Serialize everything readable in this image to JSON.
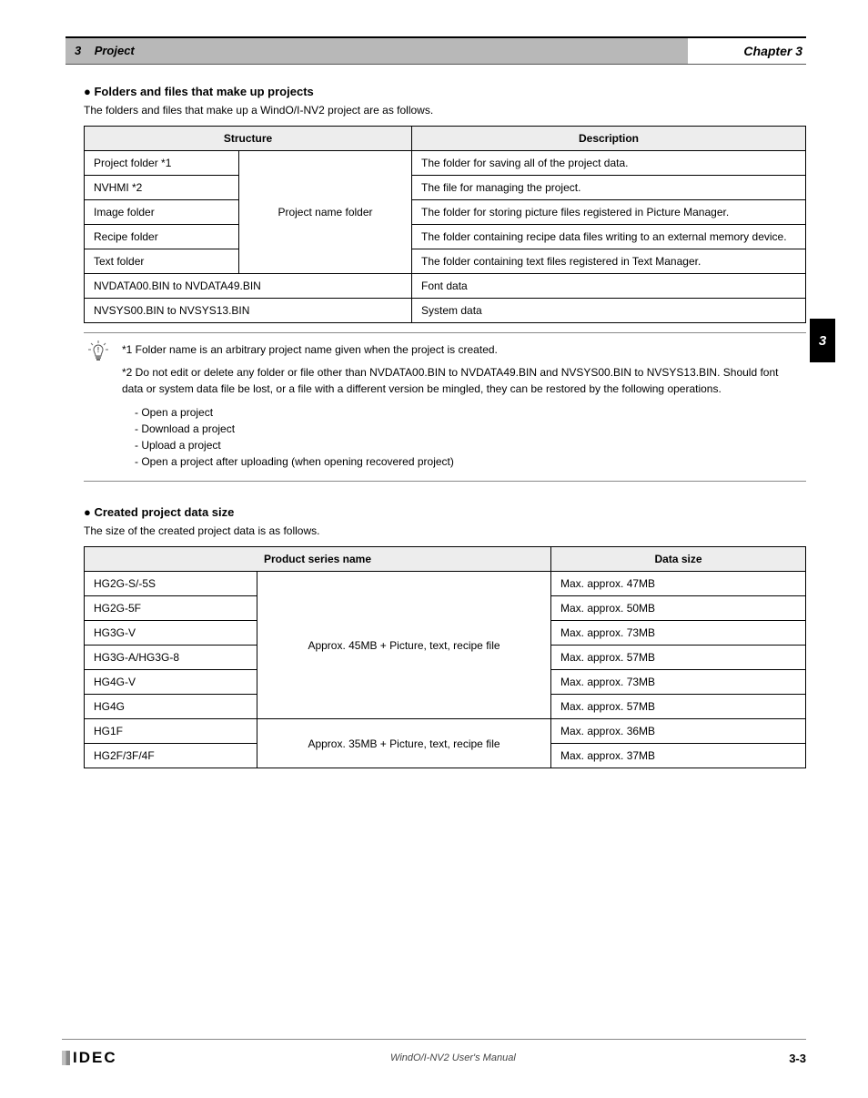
{
  "header": {
    "section_label_small": "3",
    "section_title": "Project",
    "chapter_ref": "Chapter 3"
  },
  "tab": "3",
  "section1": {
    "title": "Folders and files that make up projects",
    "desc": "The folders and files that make up a WindO/I-NV2 project are as follows.",
    "table": {
      "headers": [
        "Structure",
        "Description"
      ],
      "rows": [
        {
          "col1": "Project folder *1",
          "group": "Project name folder",
          "desc": "The folder for saving all of the project data."
        },
        {
          "col1": "NVHMI *2",
          "desc": "The file for managing the project."
        },
        {
          "col1": "Image folder",
          "desc": "The folder for storing picture files registered in Picture Manager."
        },
        {
          "col1": "Recipe folder",
          "desc": "The folder containing recipe data files writing to an external memory device."
        },
        {
          "col1": "Text folder",
          "desc": "The folder containing text files registered in Text Manager."
        },
        {
          "col1_span": "NVDATA00.BIN to NVDATA49.BIN",
          "desc": "Font data"
        },
        {
          "col1_span": "NVSYS00.BIN to NVSYS13.BIN",
          "desc": "System data"
        }
      ]
    },
    "note": {
      "p1": "*1 Folder name is an arbitrary project name given when the project is created.",
      "p2": "*2 Do not edit or delete any folder or file other than NVDATA00.BIN to NVDATA49.BIN and NVSYS00.BIN to NVSYS13.BIN. Should font data or system data file be lost, or a file with a different version be mingled, they can be restored by the following operations.",
      "b1": "- Open a project",
      "b2": "- Download a project",
      "b3": "- Upload a project",
      "b4": "- Open a project after uploading (when opening recovered project)"
    }
  },
  "section2": {
    "title": "Created project data size",
    "desc": "The size of the created project data is as follows.",
    "table": {
      "headers": [
        "Product series name",
        "Data size"
      ],
      "rows": [
        {
          "col1": "HG2G-S/-5S",
          "group": "Approx. 45MB + Picture, text, recipe file",
          "size": "Max. approx. 47MB"
        },
        {
          "col1": "HG2G-5F",
          "size": "Max. approx. 50MB"
        },
        {
          "col1": "HG3G-V",
          "size": "Max. approx. 73MB"
        },
        {
          "col1": "HG3G-A/HG3G-8",
          "size": "Max. approx. 57MB"
        },
        {
          "col1": "HG4G-V",
          "size": "Max. approx. 73MB"
        },
        {
          "col1": "HG4G",
          "size": "Max. approx. 57MB"
        },
        {
          "col1": "HG1F",
          "group2": "Approx. 35MB + Picture, text, recipe file",
          "size": "Max. approx. 36MB"
        },
        {
          "col1": "HG2F/3F/4F",
          "size": "Max. approx. 37MB"
        }
      ]
    }
  },
  "footer": {
    "doc": "WindO/I-NV2 User's Manual",
    "page": "3-3"
  }
}
